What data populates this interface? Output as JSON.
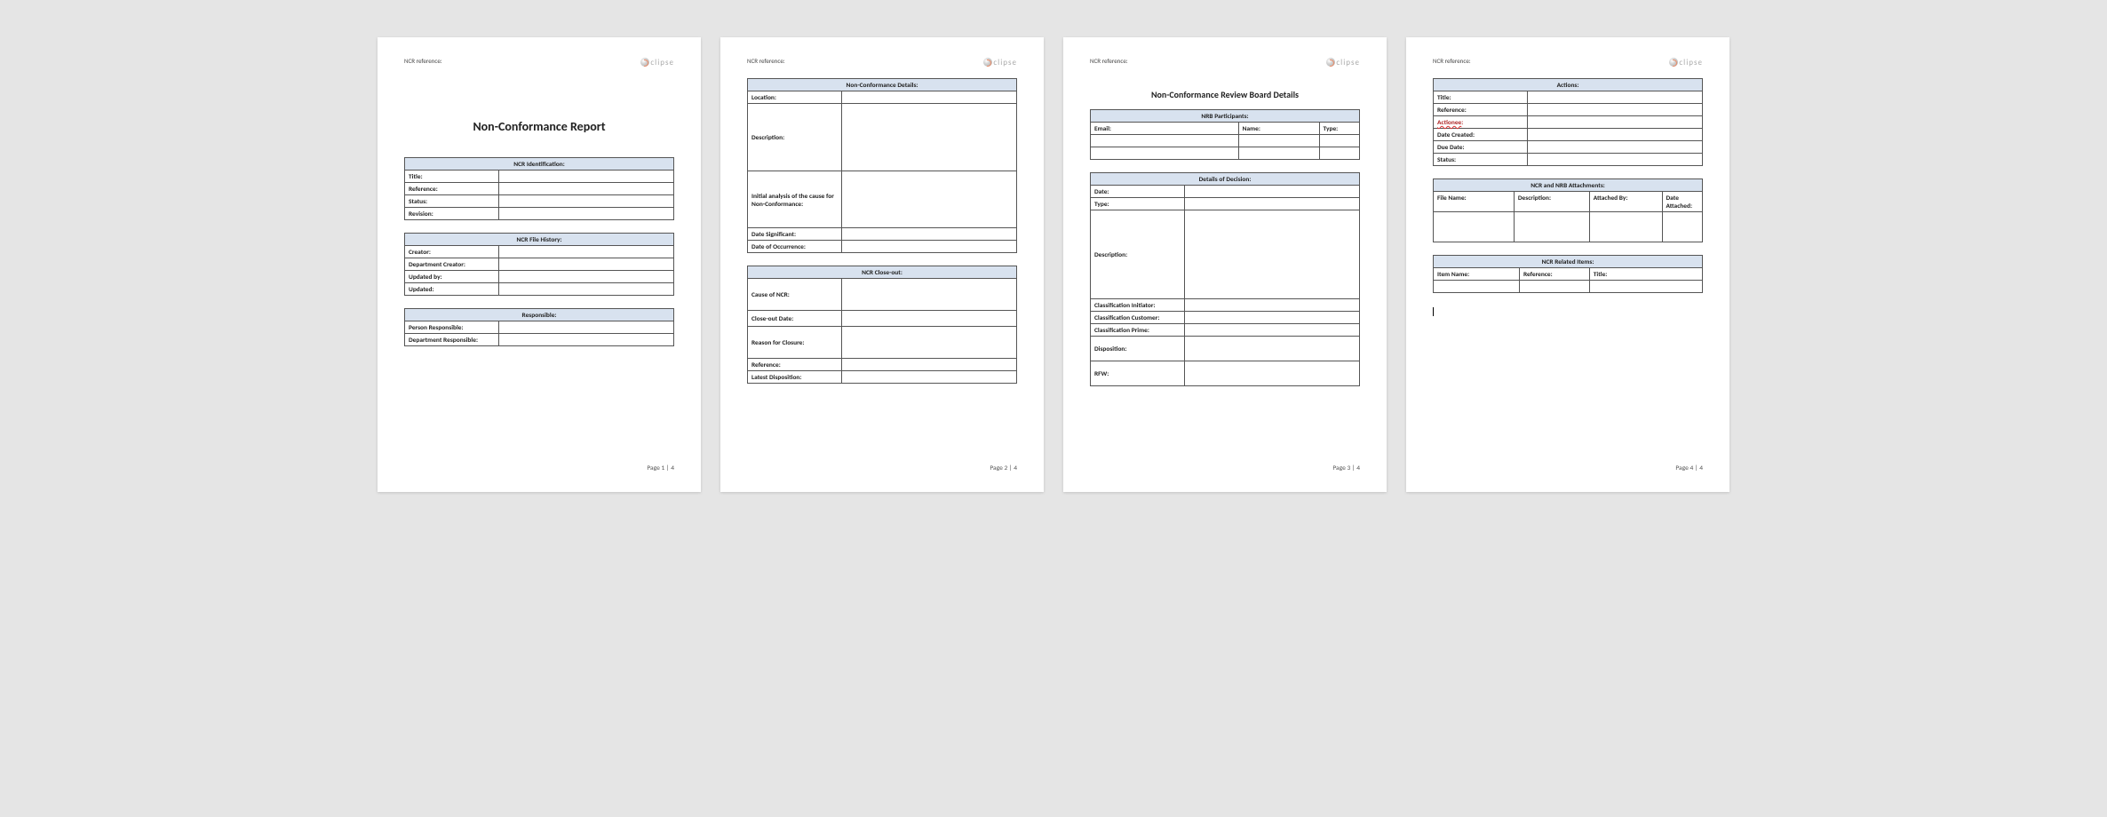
{
  "header": {
    "ncr_ref_label": "NCR reference:",
    "logo_text": "clipse"
  },
  "footer": {
    "p1": "Page 1 | 4",
    "p2": "Page 2 | 4",
    "p3": "Page 3 | 4",
    "p4": "Page 4 | 4"
  },
  "page1": {
    "title": "Non-Conformance Report",
    "tables": {
      "identification": {
        "caption": "NCR Identification:",
        "rows": [
          {
            "label": "Title:",
            "value": ""
          },
          {
            "label": "Reference:",
            "value": ""
          },
          {
            "label": "Status:",
            "value": ""
          },
          {
            "label": "Revision:",
            "value": ""
          }
        ]
      },
      "file_history": {
        "caption": "NCR File History:",
        "rows": [
          {
            "label": "Creator:",
            "value": ""
          },
          {
            "label": "Department Creator:",
            "value": ""
          },
          {
            "label": "Updated by:",
            "value": ""
          },
          {
            "label": "Updated:",
            "value": ""
          }
        ]
      },
      "responsible": {
        "caption": "Responsible:",
        "rows": [
          {
            "label": "Person Responsible:",
            "value": ""
          },
          {
            "label": "Department Responsible:",
            "value": ""
          }
        ]
      }
    }
  },
  "page2": {
    "tables": {
      "details": {
        "caption": "Non-Conformance Details:",
        "rows": [
          {
            "label": "Location:",
            "value": ""
          },
          {
            "label": "Description:",
            "value": ""
          },
          {
            "label": "Initial analysis of the cause for Non-Conformance:",
            "value": ""
          },
          {
            "label": "Date Significant:",
            "value": ""
          },
          {
            "label": "Date of Occurrence:",
            "value": ""
          }
        ]
      },
      "closeout": {
        "caption": "NCR Close-out:",
        "rows": [
          {
            "label": "Cause of NCR:",
            "value": ""
          },
          {
            "label": "Close-out Date:",
            "value": ""
          },
          {
            "label": "Reason for Closure:",
            "value": ""
          },
          {
            "label": "Reference:",
            "value": ""
          },
          {
            "label": "Latest Disposition:",
            "value": ""
          }
        ]
      }
    }
  },
  "page3": {
    "title": "Non-Conformance Review Board Details",
    "tables": {
      "participants": {
        "caption": "NRB Participants:",
        "headers": [
          "Email:",
          "Name:",
          "Type:"
        ],
        "rows": [
          [
            "",
            "",
            ""
          ],
          [
            "",
            "",
            ""
          ]
        ]
      },
      "decision": {
        "caption": "Details of Decision:",
        "rows": [
          {
            "label": "Date:",
            "value": ""
          },
          {
            "label": "Type:",
            "value": ""
          },
          {
            "label": "Description:",
            "value": ""
          },
          {
            "label": "Classification Initiator:",
            "value": ""
          },
          {
            "label": "Classification Customer:",
            "value": ""
          },
          {
            "label": "Classification Prime:",
            "value": ""
          },
          {
            "label": "Disposition:",
            "value": ""
          },
          {
            "label": "RFW:",
            "value": ""
          }
        ]
      }
    }
  },
  "page4": {
    "tables": {
      "actions": {
        "caption": "Actions:",
        "rows": [
          {
            "label": "Title:",
            "value": ""
          },
          {
            "label": "Reference:",
            "value": ""
          },
          {
            "label": "Actionee",
            "suffix": ":",
            "value": ""
          },
          {
            "label": "Date Created:",
            "value": ""
          },
          {
            "label": "Due Date:",
            "value": ""
          },
          {
            "label": "Status:",
            "value": ""
          }
        ]
      },
      "attachments": {
        "caption": "NCR and NRB Attachments:",
        "headers": [
          "File Name:",
          "Description:",
          "Attached By:",
          "Date Attached:"
        ],
        "rows": [
          [
            "",
            "",
            "",
            ""
          ]
        ]
      },
      "related": {
        "caption": "NCR Related Items:",
        "headers": [
          "Item Name:",
          "Reference:",
          "Title:"
        ],
        "rows": [
          [
            "",
            "",
            ""
          ]
        ]
      }
    }
  }
}
